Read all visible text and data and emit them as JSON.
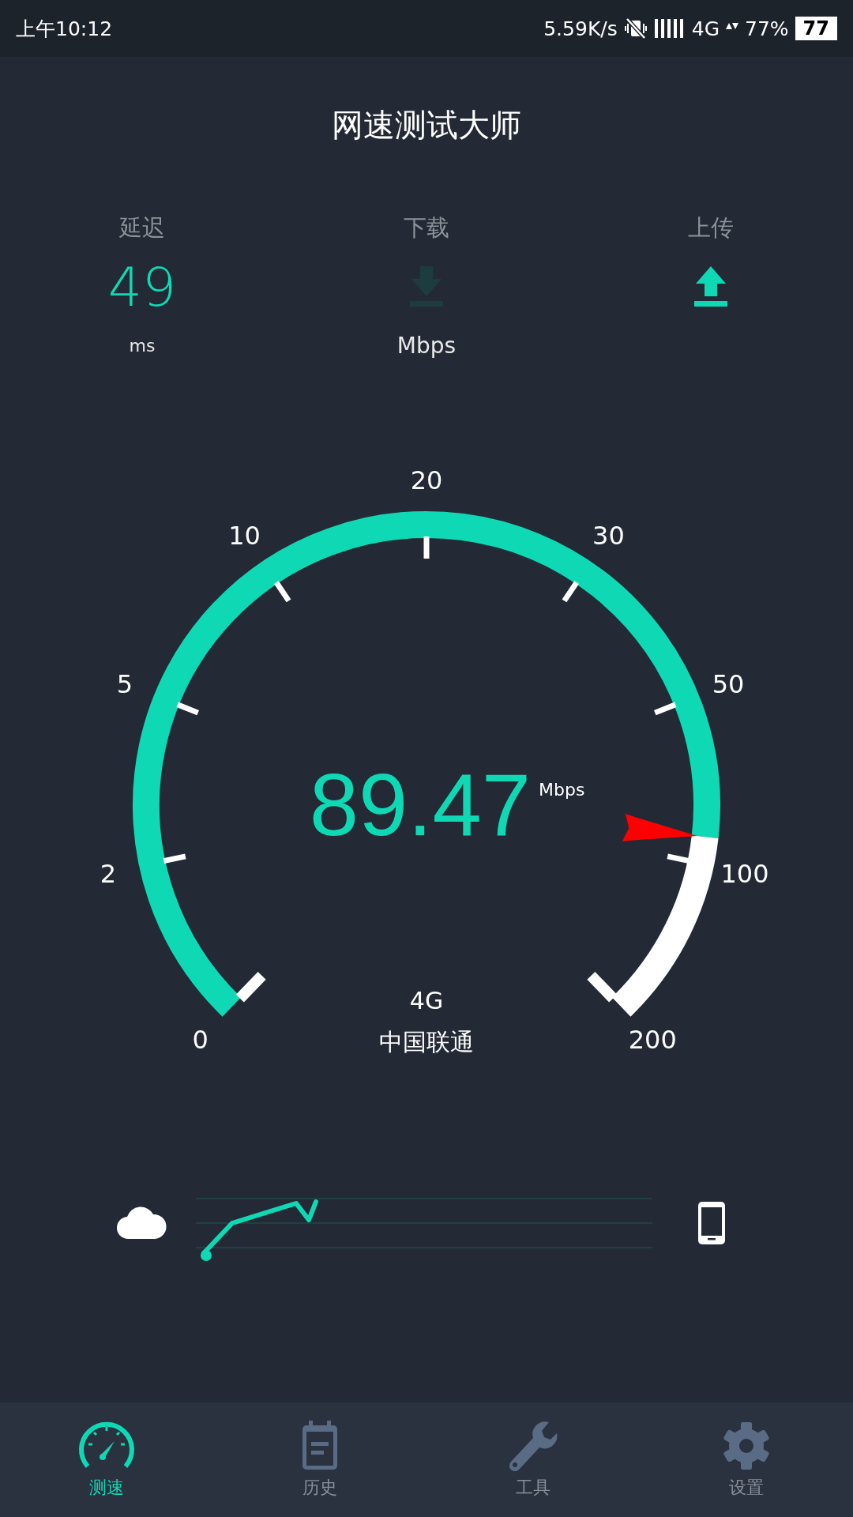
{
  "status_bar": {
    "time": "上午10:12",
    "net_speed": "5.59K/s",
    "network": "4G",
    "battery_percent": "77%",
    "battery_text": "77"
  },
  "title": "网速测试大师",
  "metrics": [
    {
      "label": "延迟",
      "kind": "value",
      "value": "49",
      "unit": "ms"
    },
    {
      "label": "下载",
      "kind": "download",
      "active": false,
      "unit": "Mbps"
    },
    {
      "label": "上传",
      "kind": "upload",
      "active": true
    }
  ],
  "gauge": {
    "scale": [
      "0",
      "2",
      "5",
      "10",
      "20",
      "30",
      "50",
      "100",
      "200"
    ],
    "value": "89.47",
    "unit": "Mbps",
    "network": "4G",
    "carrier": "中国联通"
  },
  "nav": [
    {
      "label": "测速",
      "kind": "speed",
      "selected": true
    },
    {
      "label": "历史",
      "kind": "history",
      "selected": false
    },
    {
      "label": "工具",
      "kind": "tools",
      "selected": false
    },
    {
      "label": "设置",
      "kind": "settings",
      "selected": false
    }
  ]
}
